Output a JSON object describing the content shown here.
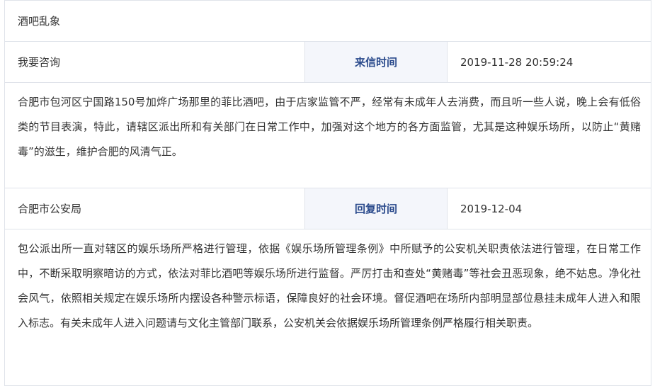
{
  "title": "酒吧乱象",
  "question": {
    "type_label": "我要咨询",
    "time_label": "来信时间",
    "time_value": "2019-11-28 20:59:24",
    "content": "合肥市包河区宁国路150号加烨广场那里的菲比酒吧，由于店家监管不严，经常有未成年人去消费，而且听一些人说，晚上会有低俗类的节目表演，特此，请辖区派出所和有关部门在日常工作中，加强对这个地方的各方面监管，尤其是这种娱乐场所，以防止“黄赌毒”的滋生，维护合肥的风清气正。"
  },
  "reply": {
    "department": "合肥市公安局",
    "time_label": "回复时间",
    "time_value": "2019-12-04",
    "content": "包公派出所一直对辖区的娱乐场所严格进行管理，依据《娱乐场所管理条例》中所赋予的公安机关职责依法进行管理，在日常工作中，不断采取明察暗访的方式，依法对菲比酒吧等娱乐场所进行监督。严厉打击和查处“黄赌毒”等社会丑恶现象，绝不姑息。净化社会风气，依照相关规定在娱乐场所内摆设各种警示标语，保障良好的社会环境。督促酒吧在场所内部明显部位悬挂未成年人进入和限入标志。有关未成年人进入问题请与文化主管部门联系，公安机关会依据娱乐场所管理条例严格履行相关职责。"
  }
}
